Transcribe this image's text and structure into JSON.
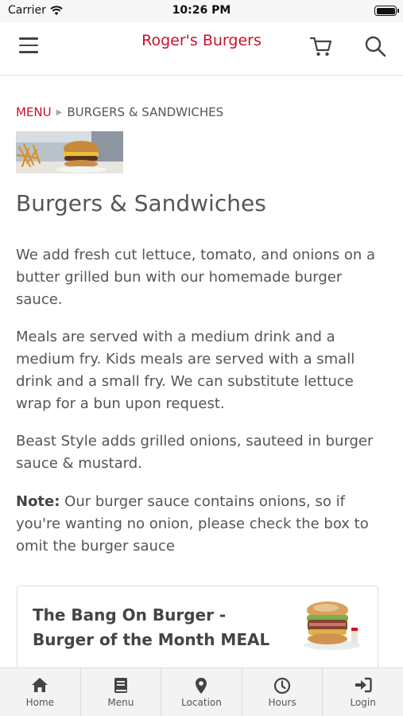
{
  "status_bar": {
    "carrier": "Carrier",
    "time": "10:26 PM"
  },
  "header": {
    "title": "Roger's Burgers",
    "accent_color": "#c8102e"
  },
  "breadcrumb": {
    "root": "MENU",
    "current": "BURGERS & SANDWICHES"
  },
  "category": {
    "title": "Burgers & Sandwiches",
    "paragraphs": [
      "We add fresh cut lettuce, tomato, and onions on a butter grilled bun with our homemade burger sauce.",
      "Meals are served with a medium drink and a medium fry. Kids meals are served with a small drink and a small fry. We can substitute lettuce wrap for a bun upon request.",
      "Beast Style adds grilled onions, sauteed in burger sauce & mustard."
    ],
    "note_label": "Note:",
    "note_text": " Our burger sauce contains onions, so if you're wanting no onion, please check the box to omit the burger sauce"
  },
  "items": [
    {
      "name": "The Bang On Burger - Burger of the Month MEAL"
    }
  ],
  "tabs": [
    {
      "label": "Home",
      "icon": "home-icon"
    },
    {
      "label": "Menu",
      "icon": "book-icon"
    },
    {
      "label": "Location",
      "icon": "map-pin-icon"
    },
    {
      "label": "Hours",
      "icon": "clock-icon"
    },
    {
      "label": "Login",
      "icon": "sign-in-icon"
    }
  ]
}
